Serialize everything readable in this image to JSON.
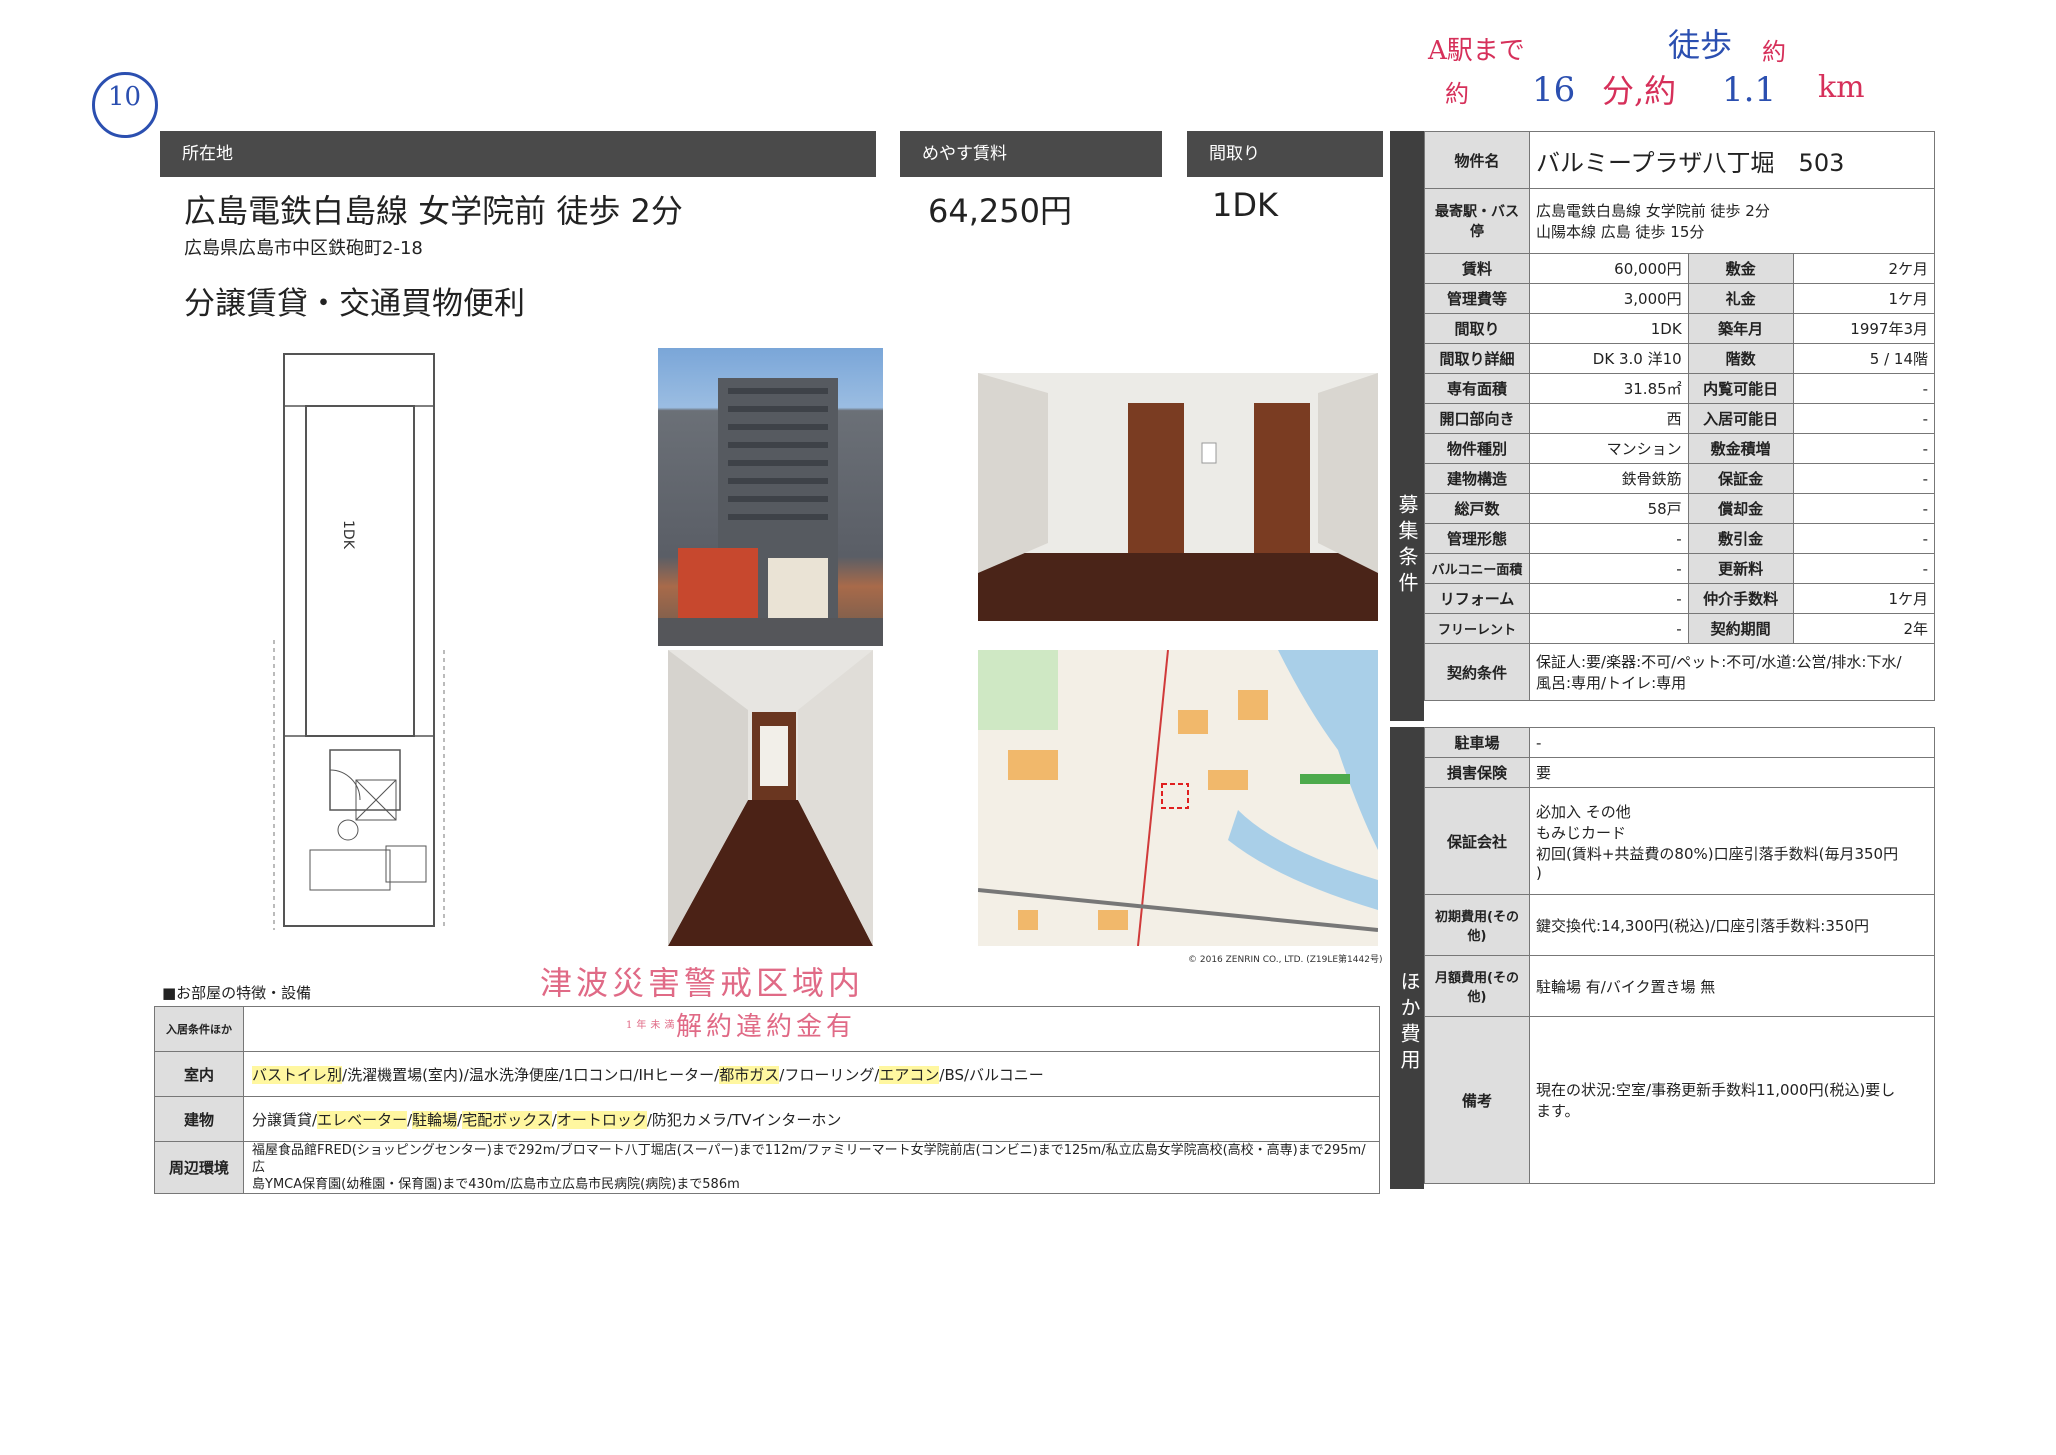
{
  "handwritten": {
    "circle_number": "10",
    "note_line1_red": "A駅まで",
    "note_line1_blue": "徒歩",
    "note_line1_tail": "約",
    "note_line2_prefix": "約",
    "note_minutes": "16",
    "note_unit": "分,約",
    "note_distance": "1.1",
    "note_km": "km"
  },
  "header": {
    "location_label": "所在地",
    "rent_label": "めやす賃料",
    "layout_label": "間取り"
  },
  "summary": {
    "station": "広島電鉄白島線 女学院前 徒歩 2分",
    "address": "広島県広島市中区鉄砲町2-18",
    "rent": "64,250円",
    "layout": "1DK",
    "catchphrase": "分譲賃貸・交通買物便利"
  },
  "floorplan": {
    "label": "1DK"
  },
  "map": {
    "copyright": "© 2016 ZENRIN CO., LTD. (Z19LE第1442号)"
  },
  "stamps": {
    "tsunami": "津波災害警戒区域内",
    "penalty_prefix": "1年未満",
    "penalty": "解約違約金有"
  },
  "property": {
    "name_label": "物件名",
    "name": "バルミープラザ八丁堀　503",
    "station_label": "最寄駅・バス停",
    "station_line1": "広島電鉄白島線 女学院前 徒歩 2分",
    "station_line2": "山陽本線 広島 徒歩 15分"
  },
  "recruit_side": "募集条件",
  "other_side": "ほか費用",
  "conditions": [
    {
      "k1": "賃料",
      "v1": "60,000円",
      "k2": "敷金",
      "v2": "2ケ月"
    },
    {
      "k1": "管理費等",
      "v1": "3,000円",
      "k2": "礼金",
      "v2": "1ケ月"
    },
    {
      "k1": "間取り",
      "v1": "1DK",
      "k2": "築年月",
      "v2": "1997年3月"
    },
    {
      "k1": "間取り詳細",
      "v1": "DK 3.0 洋10",
      "k2": "階数",
      "v2": "5 / 14階"
    },
    {
      "k1": "専有面積",
      "v1": "31.85㎡",
      "k2": "内覧可能日",
      "v2": "-"
    },
    {
      "k1": "開口部向き",
      "v1": "西",
      "k2": "入居可能日",
      "v2": "-"
    },
    {
      "k1": "物件種別",
      "v1": "マンション",
      "k2": "敷金積増",
      "v2": "-"
    },
    {
      "k1": "建物構造",
      "v1": "鉄骨鉄筋",
      "k2": "保証金",
      "v2": "-"
    },
    {
      "k1": "総戸数",
      "v1": "58戸",
      "k2": "償却金",
      "v2": "-"
    },
    {
      "k1": "管理形態",
      "v1": "-",
      "k2": "敷引金",
      "v2": "-"
    },
    {
      "k1": "バルコニー面積",
      "v1": "-",
      "k2": "更新料",
      "v2": "-"
    },
    {
      "k1": "リフォーム",
      "v1": "-",
      "k2": "仲介手数料",
      "v2": "1ケ月"
    },
    {
      "k1": "フリーレント",
      "v1": "-",
      "k2": "契約期間",
      "v2": "2年"
    }
  ],
  "contract": {
    "label": "契約条件",
    "line1": "保証人:要/楽器:不可/ペット:不可/水道:公営/排水:下水/",
    "line2": "風呂:専用/トイレ:専用"
  },
  "others": {
    "parking_label": "駐車場",
    "parking": "-",
    "insurance_label": "損害保険",
    "insurance": "要",
    "guarantor_label": "保証会社",
    "guarantor_line1": "必加入 その他",
    "guarantor_line2": "もみじカード",
    "guarantor_line3": "初回(賃料+共益費の80%)口座引落手数料(毎月350円",
    "guarantor_line4": ")",
    "initial_label": "初期費用(その他)",
    "initial": "鍵交換代:14,300円(税込)/口座引落手数料:350円",
    "monthly_label": "月額費用(その他)",
    "monthly": "駐輪場 有/バイク置き場 無",
    "remarks_label": "備考",
    "remarks_line1": "現在の状況:空室/事務更新手数料11,000円(税込)要し",
    "remarks_line2": "ます。"
  },
  "features": {
    "title": "■お部屋の特徴・設備",
    "move_in_label": "入居条件ほか",
    "indoor_label": "室内",
    "indoor": [
      {
        "text": "バストイレ別",
        "hl": true
      },
      {
        "text": "/洗濯機置場(室内)/温水洗浄便座/1口コンロ/IHヒーター/",
        "hl": false
      },
      {
        "text": "都市ガス",
        "hl": true
      },
      {
        "text": "/フローリング/",
        "hl": false
      },
      {
        "text": "エアコン",
        "hl": true
      },
      {
        "text": "/BS/バルコニー",
        "hl": false
      }
    ],
    "building_label": "建物",
    "building": [
      {
        "text": "分譲賃貸/",
        "hl": false
      },
      {
        "text": "エレベーター",
        "hl": true
      },
      {
        "text": "/",
        "hl": false
      },
      {
        "text": "駐輪場",
        "hl": true
      },
      {
        "text": "/",
        "hl": false
      },
      {
        "text": "宅配ボックス",
        "hl": true
      },
      {
        "text": "/",
        "hl": false
      },
      {
        "text": "オートロック",
        "hl": true
      },
      {
        "text": "/防犯カメラ/TVインターホン",
        "hl": false
      }
    ],
    "surroundings_label": "周辺環境",
    "surroundings_line1": "福屋食品館FRED(ショッピングセンター)まで292m/ブロマート八丁堀店(スーパー)まで112m/ファミリーマート女学院前店(コンビニ)まで125m/私立広島女学院高校(高校・高専)まで295m/広",
    "surroundings_line2": "島YMCA保育園(幼稚園・保育園)まで430m/広島市立広島市民病院(病院)まで586m"
  }
}
